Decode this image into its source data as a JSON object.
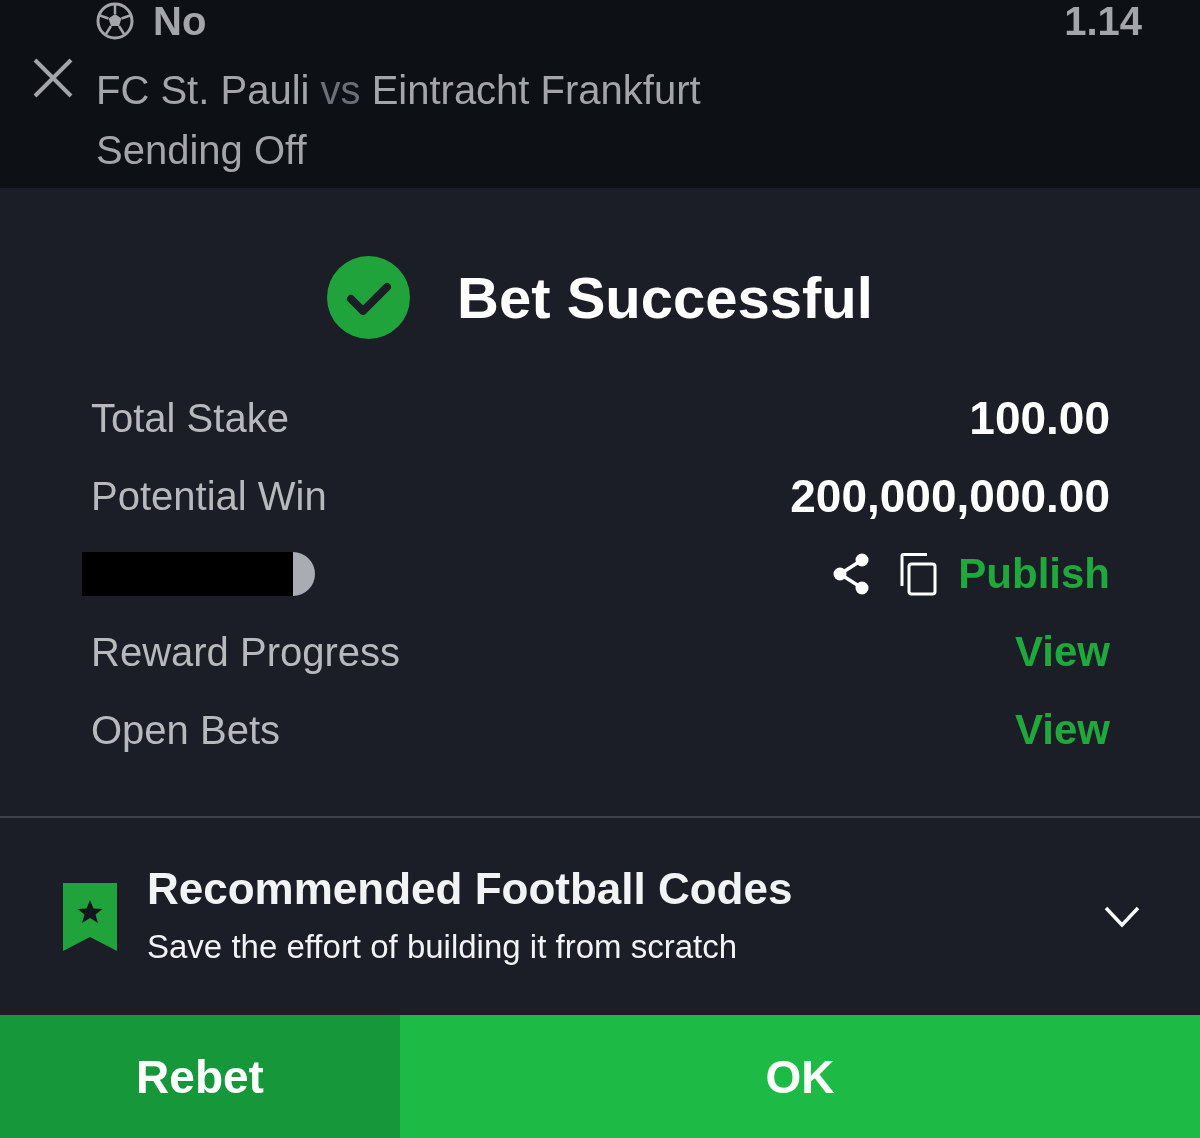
{
  "selection": {
    "pick": "No",
    "odds": "1.14",
    "match": {
      "home": "FC St. Pauli",
      "separator": "vs",
      "away": "Eintracht Frankfurt"
    },
    "market": "Sending Off"
  },
  "result": {
    "title": "Bet Successful"
  },
  "summary": [
    {
      "kind": "value",
      "label": "Total Stake",
      "value": "100.00"
    },
    {
      "kind": "value",
      "label": "Potential Win",
      "value": "200,000,000.00"
    },
    {
      "kind": "share",
      "action": "Publish"
    },
    {
      "kind": "link",
      "label": "Reward Progress",
      "action": "View"
    },
    {
      "kind": "link",
      "label": "Open Bets",
      "action": "View"
    }
  ],
  "recommendation": {
    "title": "Recommended Football Codes",
    "subtitle": "Save the effort of building it from scratch",
    "expanded": false
  },
  "buttons": [
    {
      "kind": "secondary",
      "label": "Rebet"
    },
    {
      "kind": "primary",
      "label": "OK"
    }
  ]
}
